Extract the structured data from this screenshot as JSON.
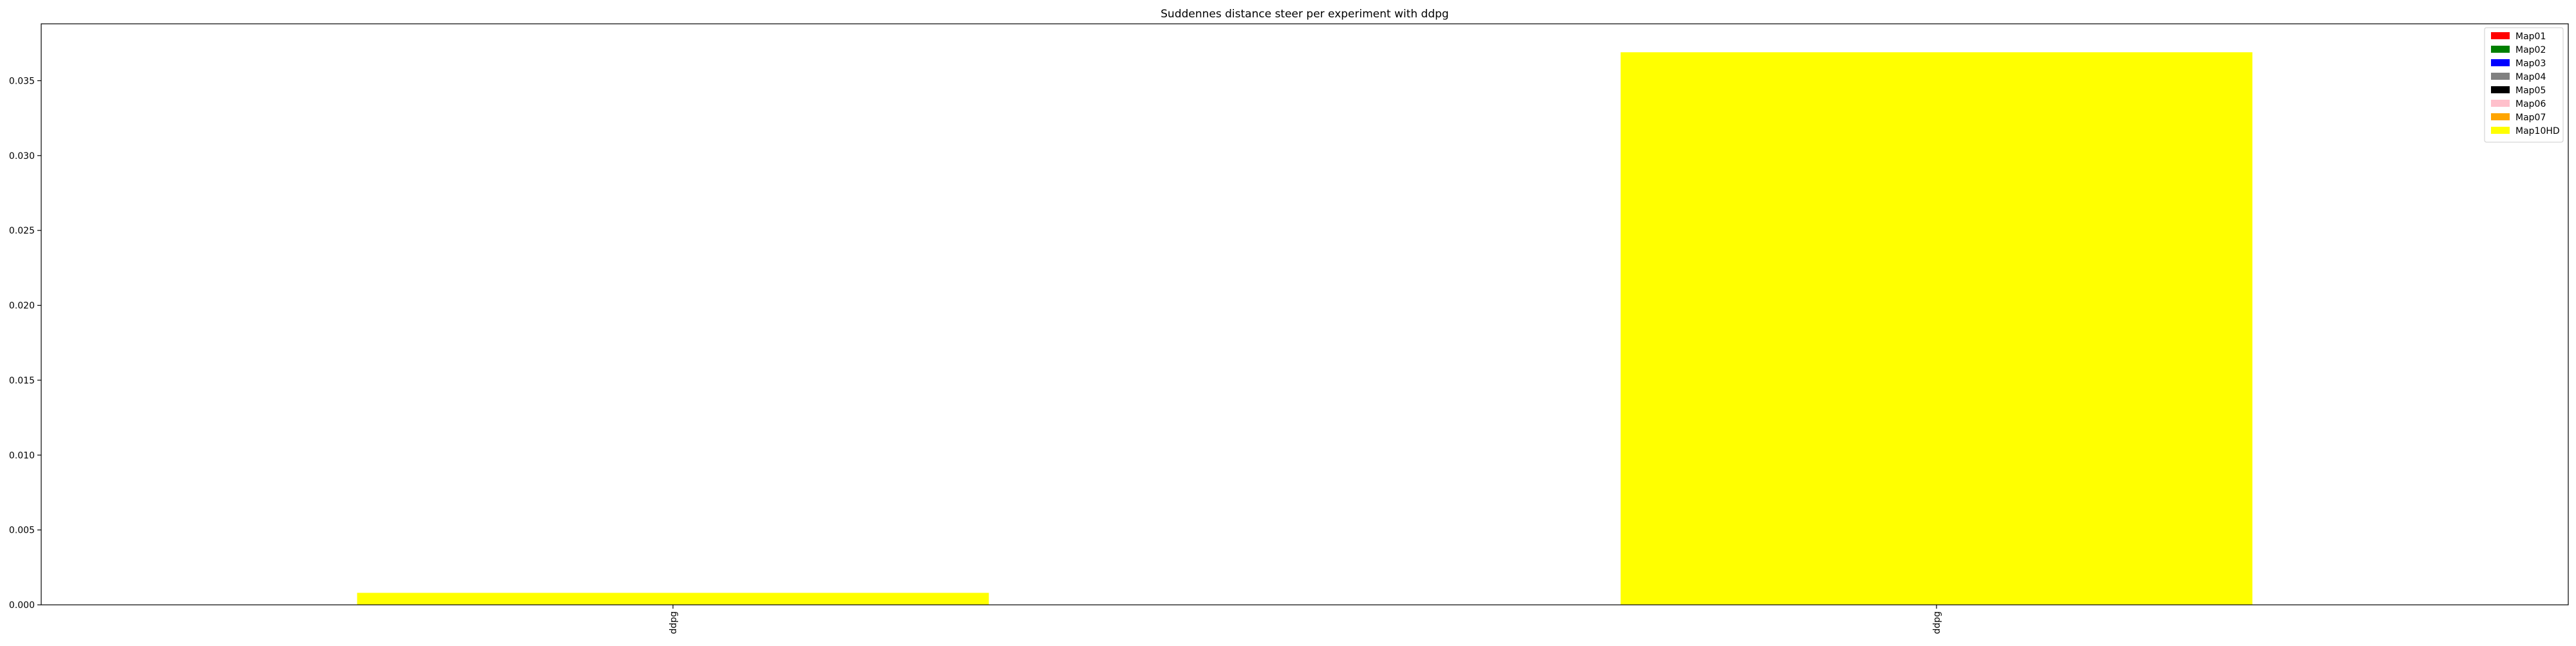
{
  "chart_data": {
    "type": "bar",
    "title": "Suddennes distance steer per experiment with ddpg",
    "xlabel": "",
    "ylabel": "",
    "categories": [
      "ddpg",
      "ddpg"
    ],
    "series": [
      {
        "name": "Map01",
        "color": "#ff0000",
        "values": [
          0,
          0
        ]
      },
      {
        "name": "Map02",
        "color": "#008000",
        "values": [
          0,
          0
        ]
      },
      {
        "name": "Map03",
        "color": "#0000ff",
        "values": [
          0,
          0
        ]
      },
      {
        "name": "Map04",
        "color": "#808080",
        "values": [
          0,
          0
        ]
      },
      {
        "name": "Map05",
        "color": "#000000",
        "values": [
          0,
          0
        ]
      },
      {
        "name": "Map06",
        "color": "#ffc0cb",
        "values": [
          0,
          0
        ]
      },
      {
        "name": "Map07",
        "color": "#ffa500",
        "values": [
          0,
          0
        ]
      },
      {
        "name": "Map10HD",
        "color": "#ffff00",
        "values": [
          0.0008,
          0.0369
        ]
      }
    ],
    "ylim": [
      0,
      0.0388
    ],
    "yticks": [
      {
        "value": 0.0,
        "label": "0.000"
      },
      {
        "value": 0.005,
        "label": "0.005"
      },
      {
        "value": 0.01,
        "label": "0.010"
      },
      {
        "value": 0.015,
        "label": "0.015"
      },
      {
        "value": 0.02,
        "label": "0.020"
      },
      {
        "value": 0.025,
        "label": "0.025"
      },
      {
        "value": 0.03,
        "label": "0.030"
      },
      {
        "value": 0.035,
        "label": "0.035"
      }
    ],
    "grid": false,
    "legend_position": "top-right"
  }
}
